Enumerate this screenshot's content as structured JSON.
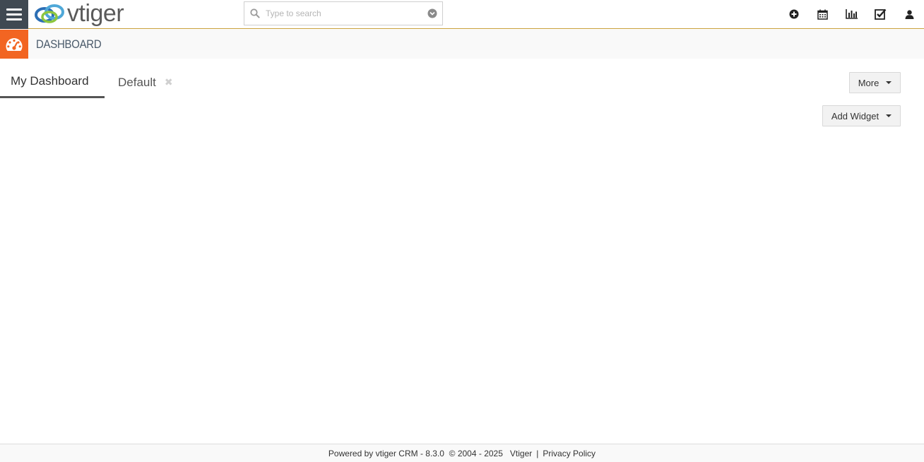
{
  "header": {
    "logo_text": "vtiger",
    "search": {
      "placeholder": "Type to search",
      "value": ""
    },
    "icons": [
      "plus-circle-icon",
      "calendar-icon",
      "bar-chart-icon",
      "checkbox-icon",
      "user-icon"
    ]
  },
  "module": {
    "title": "DASHBOARD",
    "icon": "dashboard-gauge-icon",
    "accent": "#f26522"
  },
  "tabs": [
    {
      "label": "My Dashboard",
      "active": true
    },
    {
      "label": "Default",
      "active": false
    }
  ],
  "buttons": {
    "more": "More",
    "add_widget": "Add Widget"
  },
  "footer": {
    "powered": "Powered by vtiger CRM - 8.3.0  © 2004 - 2025",
    "vtiger_link": "Vtiger",
    "separator": "|",
    "privacy": "Privacy Policy"
  },
  "colors": {
    "sidebar_dark": "#404952",
    "header_border": "#c9a03a"
  }
}
